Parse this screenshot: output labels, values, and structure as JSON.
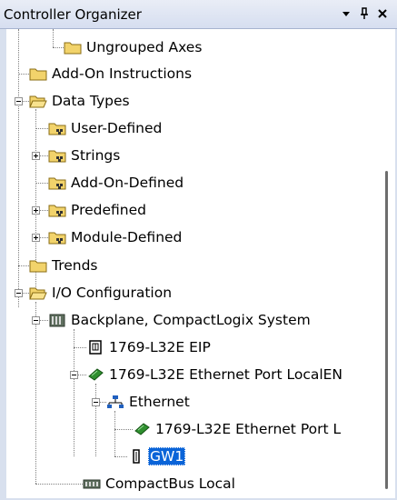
{
  "panel": {
    "title": "Controller Organizer",
    "dropdown_glyph": "▾",
    "pin_glyph": "ᛁ",
    "close_glyph": "✕"
  },
  "tree": {
    "ungrouped_axes": "Ungrouped Axes",
    "add_on_instructions": "Add-On Instructions",
    "data_types": "Data Types",
    "user_defined": "User-Defined",
    "strings": "Strings",
    "add_on_defined": "Add-On-Defined",
    "predefined": "Predefined",
    "module_defined": "Module-Defined",
    "trends": "Trends",
    "io_configuration": "I/O Configuration",
    "backplane": "Backplane, CompactLogix System",
    "l32e_eip": "1769-L32E EIP",
    "l32e_ethernet_port": "1769-L32E Ethernet Port LocalEN",
    "ethernet": "Ethernet",
    "l32e_ethernet_port_l": "1769-L32E Ethernet Port L",
    "gw1": "GW1",
    "compactbus_local": "CompactBus Local"
  },
  "colors": {
    "selection": "#0a64d8",
    "folder": "#f2d36b",
    "titlebar": "#d6def0"
  },
  "icons": {
    "folder": "folder-icon",
    "datatype_folder": "datatype-folder-icon",
    "io_folder": "io-folder-icon",
    "rack": "rack-icon",
    "controller": "controller-icon",
    "ethernet_module": "ethernet-module-icon",
    "network": "network-icon",
    "device": "device-icon",
    "bus": "bus-icon"
  }
}
